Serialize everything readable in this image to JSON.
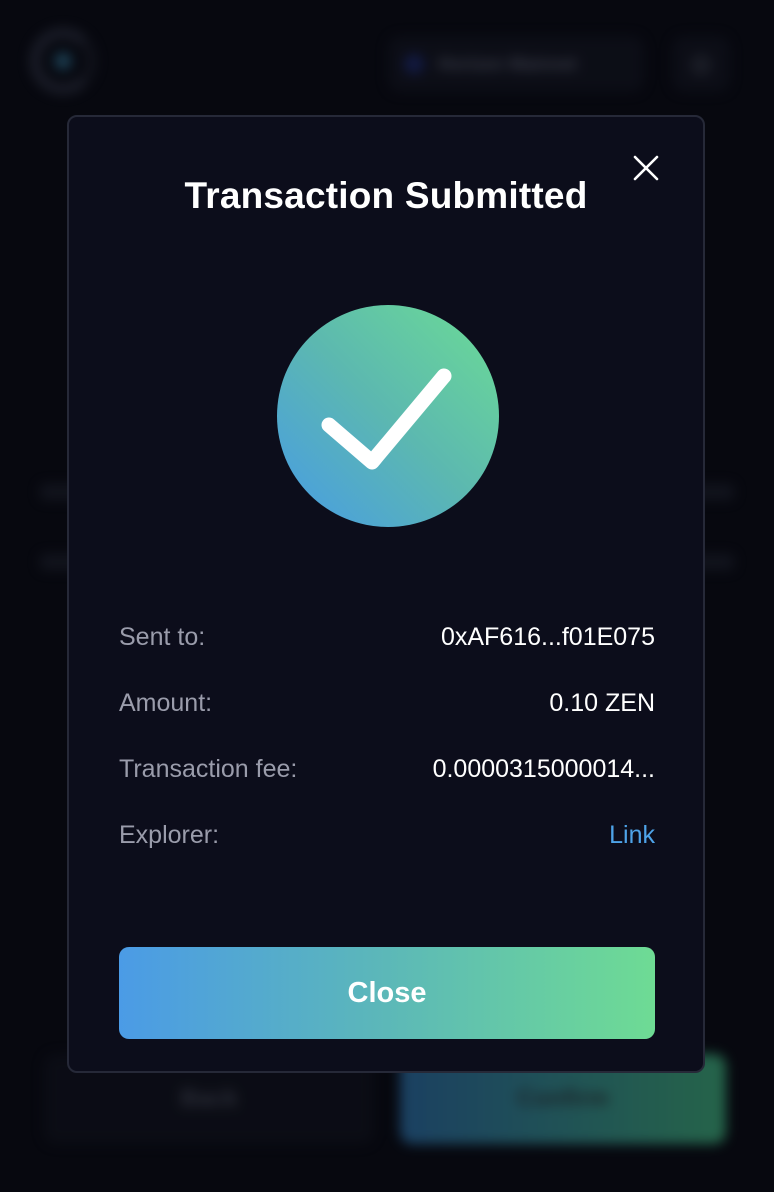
{
  "background": {
    "network_label": "Horizen Mainnet",
    "back_label": "Back",
    "confirm_label": "Confirm"
  },
  "modal": {
    "title": "Transaction Submitted",
    "close_icon": "close-icon",
    "status_icon": "checkmark-icon",
    "details": [
      {
        "label": "Sent to:",
        "value": "0xAF616...f01E075"
      },
      {
        "label": "Amount:",
        "value": "0.10 ZEN"
      },
      {
        "label": "Transaction fee:",
        "value": "0.0000315000014..."
      },
      {
        "label": "Explorer:",
        "value": "Link"
      }
    ],
    "close_button_label": "Close"
  },
  "colors": {
    "modal_bg": "#0c0d1b",
    "accent_blue": "#4b9be6",
    "accent_green": "#6edb94",
    "link": "#4ea3e8",
    "label": "#9a9cab"
  }
}
